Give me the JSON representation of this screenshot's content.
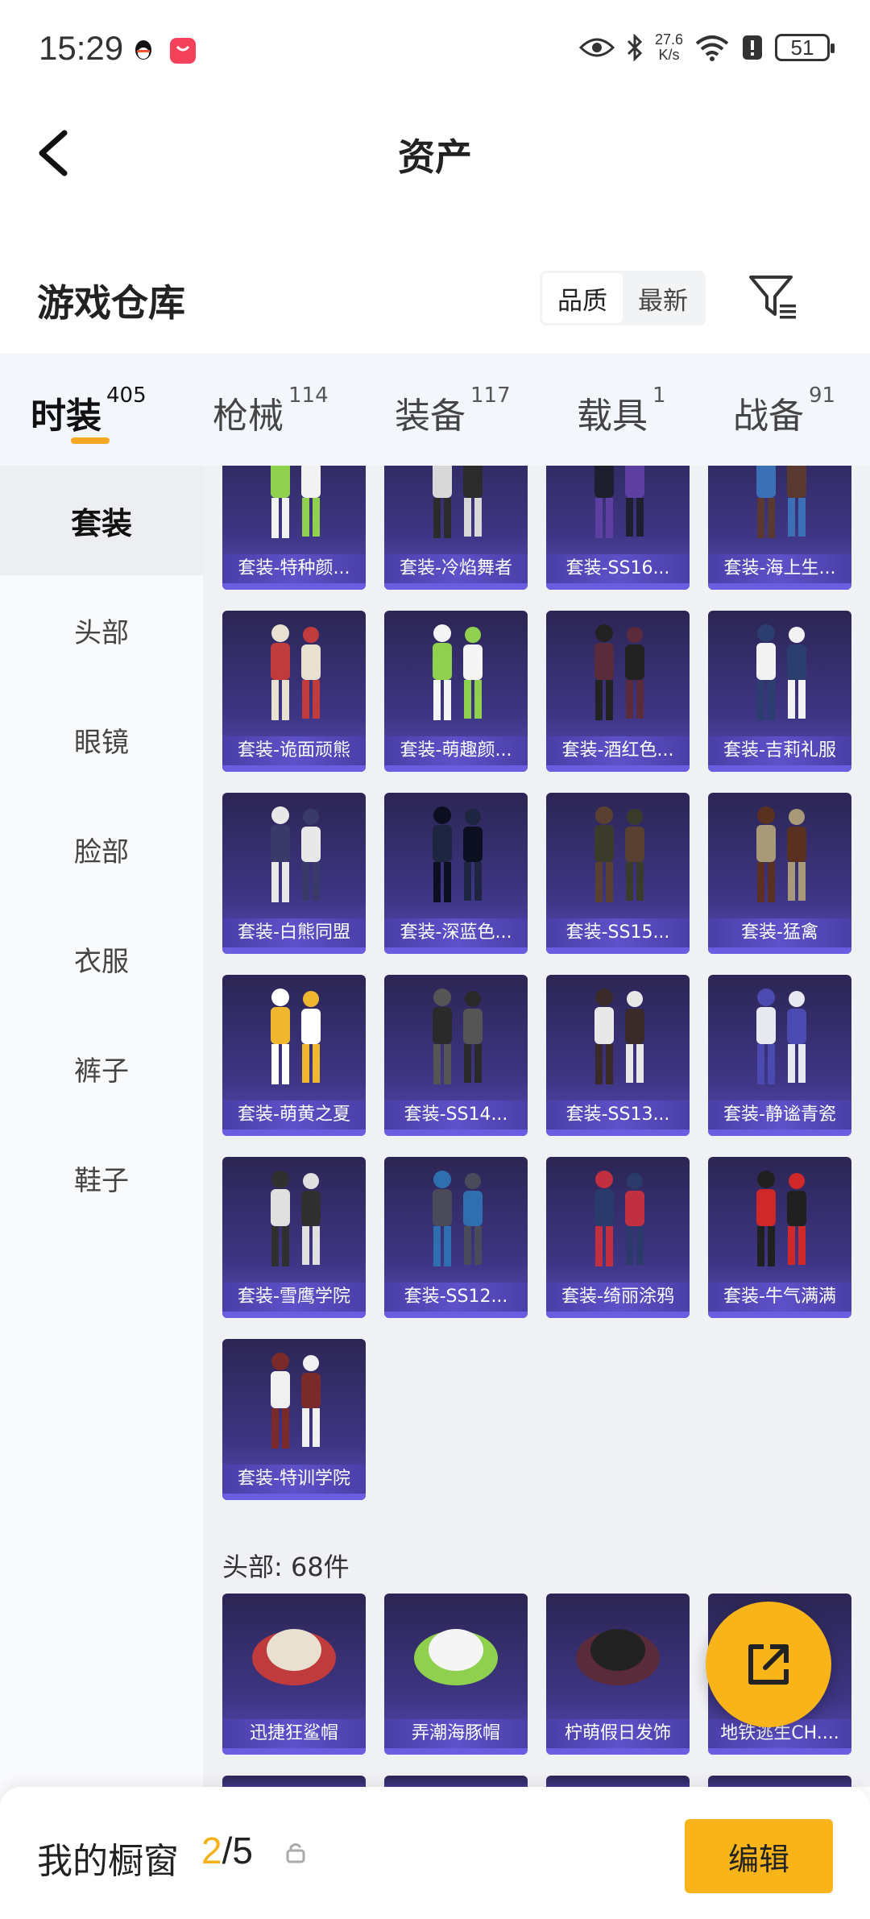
{
  "status": {
    "time": "15:29",
    "speed_top": "27.6",
    "speed_bottom": "K/s",
    "battery": "51"
  },
  "header": {
    "title": "资产"
  },
  "warehouse": {
    "title": "游戏仓库",
    "sort_options": [
      "品质",
      "最新"
    ],
    "sort_selected": "品质"
  },
  "tabs": [
    {
      "label": "时装",
      "count": "405",
      "active": true
    },
    {
      "label": "枪械",
      "count": "114",
      "active": false
    },
    {
      "label": "装备",
      "count": "117",
      "active": false
    },
    {
      "label": "载具",
      "count": "1",
      "active": false
    },
    {
      "label": "战备",
      "count": "91",
      "active": false
    }
  ],
  "sidebar": {
    "items": [
      "套装",
      "头部",
      "眼镜",
      "脸部",
      "衣服",
      "裤子",
      "鞋子"
    ],
    "active": "套装"
  },
  "grid": {
    "suits": [
      "套装-特种颜...",
      "套装-冷焰舞者",
      "套装-SS16...",
      "套装-海上生...",
      "套装-诡面顽熊",
      "套装-萌趣颜...",
      "套装-酒红色...",
      "套装-吉莉礼服",
      "套装-白熊同盟",
      "套装-深蓝色...",
      "套装-SS15...",
      "套装-猛禽",
      "套装-萌黄之夏",
      "套装-SS14...",
      "套装-SS13...",
      "套装-静谧青瓷",
      "套装-雪鹰学院",
      "套装-SS12...",
      "套装-绮丽涂鸦",
      "套装-牛气满满",
      "套装-特训学院"
    ],
    "head_section_label": "头部: 68件",
    "heads": [
      "迅捷狂鲨帽",
      "弄潮海豚帽",
      "柠萌假日发饰",
      "地铁逃生CH...."
    ]
  },
  "footer": {
    "label": "我的橱窗",
    "current": "2",
    "separator": "/",
    "total": "5",
    "edit_label": "编辑"
  }
}
